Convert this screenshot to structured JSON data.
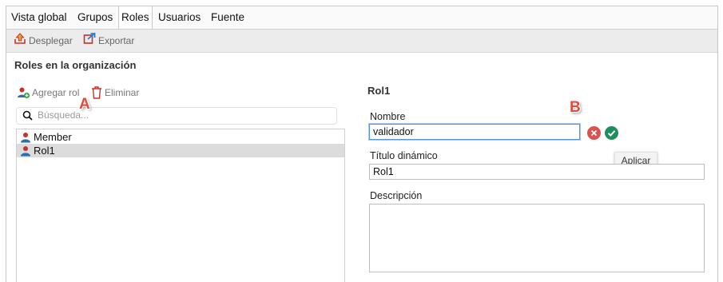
{
  "tabs": [
    {
      "label": "Vista global"
    },
    {
      "label": "Grupos"
    },
    {
      "label": "Roles"
    },
    {
      "label": "Usuarios"
    },
    {
      "label": "Fuente"
    }
  ],
  "active_tab": "Roles",
  "toolbar": {
    "deploy_label": "Desplegar",
    "export_label": "Exportar"
  },
  "section_title": "Roles en la organización",
  "list_actions": {
    "add_label": "Agregar rol",
    "delete_label": "Eliminar"
  },
  "search": {
    "placeholder": "Búsqueda..."
  },
  "roles": [
    {
      "name": "Member",
      "selected": false
    },
    {
      "name": "Rol1",
      "selected": true
    }
  ],
  "detail": {
    "title": "Rol1",
    "name_label": "Nombre",
    "name_value": "validador",
    "dynamic_title_label": "Título dinámico",
    "dynamic_title_value": "Rol1",
    "description_label": "Descripción",
    "description_value": ""
  },
  "tooltip": "Aplicar",
  "annotations": {
    "a": "A",
    "b": "B"
  },
  "colors": {
    "accent_red": "#e24b3d",
    "cancel": "#d9534f",
    "apply": "#1e8e5a",
    "focus_border": "#5b92d6",
    "selection": "#dcdcdc"
  },
  "icons": {
    "deploy": "deploy-icon",
    "export": "export-icon",
    "add_role": "add-user-icon",
    "delete": "trash-icon",
    "search": "search-icon",
    "role": "user-icon",
    "cancel": "cancel-icon",
    "apply": "check-icon"
  }
}
